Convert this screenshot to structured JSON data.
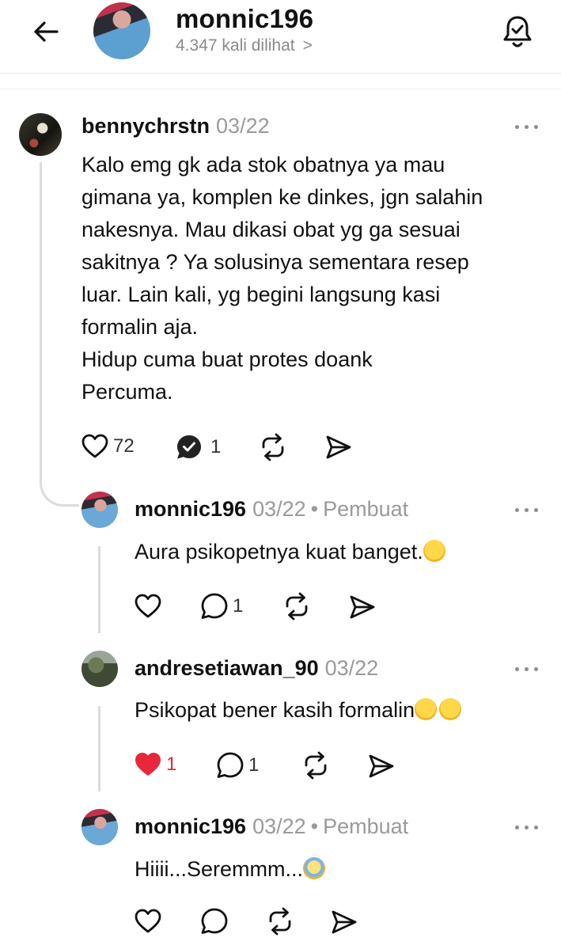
{
  "header": {
    "username": "monnic196",
    "views": "4.347 kali dilihat",
    "chevron": ">",
    "icons": {
      "back": "back-arrow-icon",
      "bell": "notification-bell-icon"
    }
  },
  "comments": [
    {
      "username": "bennychrstn",
      "date": "03/22",
      "text": "Kalo emg gk ada stok obatnya ya mau\ngimana ya, komplen ke dinkes, jgn salahin\nnakesnya. Mau dikasi obat yg ga sesuai\nsakitnya ? Ya solusinya sementara resep\nluar. Lain kali, yg begini langsung kasi\nformalin aja.\nHidup cuma buat protes doank\nPercuma.",
      "likes": "72",
      "replies": "1"
    },
    {
      "username": "monnic196",
      "date": "03/22",
      "role": "Pembuat",
      "text": "Aura psikopetnya kuat banget.",
      "emoji": "face-with-hand-over-mouth",
      "replies": "1"
    },
    {
      "username": "andresetiawan_90",
      "date": "03/22",
      "text": "Psikopat bener kasih formalin",
      "emoji": "face-with-tears-of-joy x2",
      "likes": "1",
      "liked": true,
      "replies": "1"
    },
    {
      "username": "monnic196",
      "date": "03/22",
      "role": "Pembuat",
      "text": "Hiiii...Seremmm...",
      "emoji": "face-screaming-in-fear"
    }
  ],
  "separator": "•",
  "colors": {
    "liked": "#e8273c",
    "muted": "#9a9a9a",
    "text": "#111111",
    "thread": "#dcdcdc"
  }
}
